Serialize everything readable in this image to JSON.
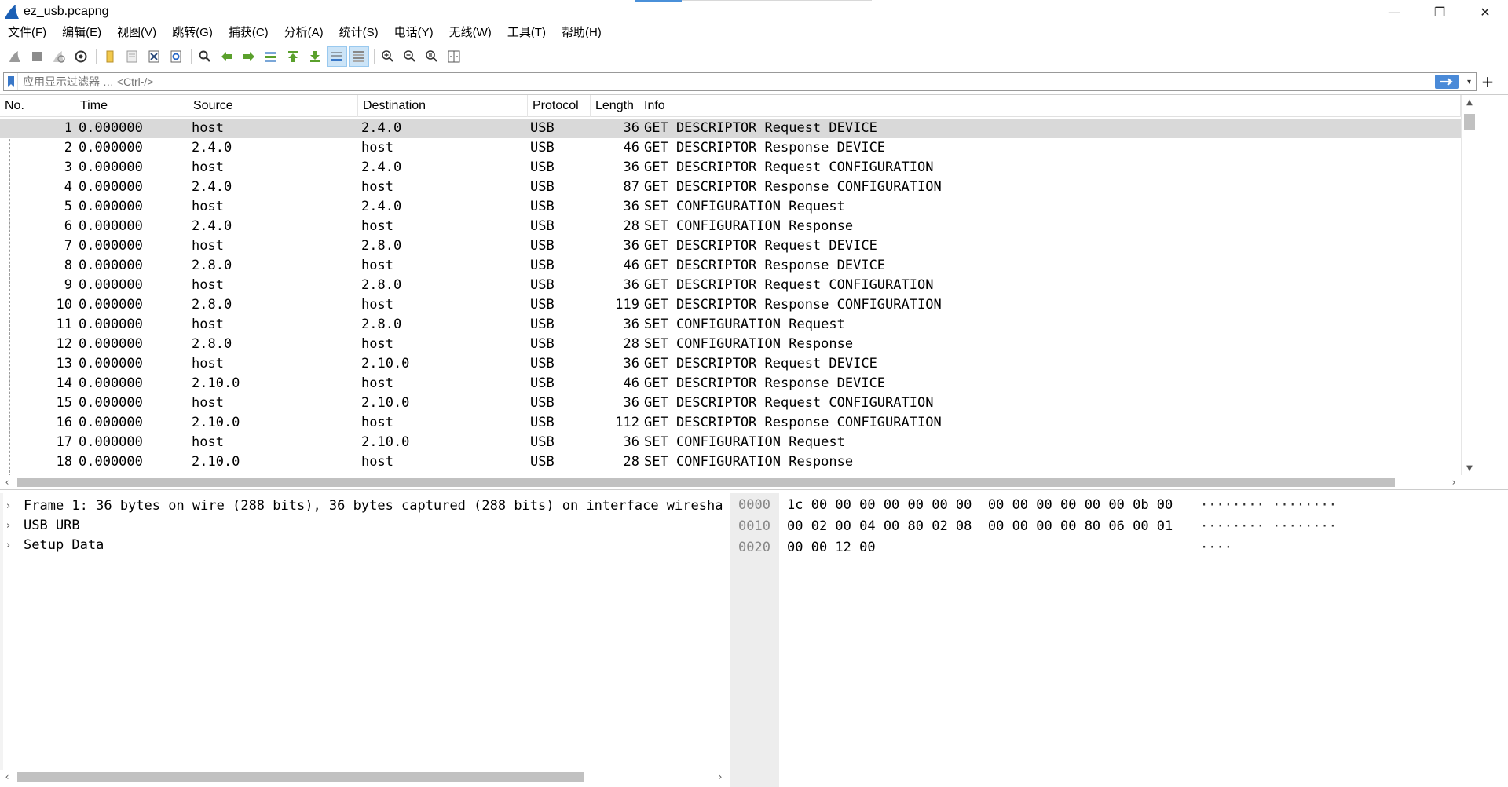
{
  "window": {
    "title": "ez_usb.pcapng",
    "minimize": "—",
    "restore": "❐",
    "close": "✕"
  },
  "menu": [
    "文件(F)",
    "编辑(E)",
    "视图(V)",
    "跳转(G)",
    "捕获(C)",
    "分析(A)",
    "统计(S)",
    "电话(Y)",
    "无线(W)",
    "工具(T)",
    "帮助(H)"
  ],
  "toolbar": {
    "icons": [
      "start-capture-icon",
      "stop-capture-icon",
      "restart-capture-icon",
      "capture-options-icon",
      "open-file-icon",
      "save-file-icon",
      "close-file-icon",
      "reload-file-icon",
      "find-packet-icon",
      "go-back-icon",
      "go-forward-icon",
      "go-to-packet-icon",
      "go-first-icon",
      "go-last-icon",
      "auto-scroll-icon",
      "colorize-icon",
      "zoom-in-icon",
      "zoom-out-icon",
      "normal-size-icon",
      "resize-columns-icon"
    ]
  },
  "filter": {
    "placeholder": "应用显示过滤器 … <Ctrl-/>",
    "plus": "+"
  },
  "packet_list": {
    "columns": [
      "No.",
      "Time",
      "Source",
      "Destination",
      "Protocol",
      "Length",
      "Info"
    ],
    "rows": [
      [
        "1",
        "0.000000",
        "host",
        "2.4.0",
        "USB",
        "36",
        "GET DESCRIPTOR Request DEVICE"
      ],
      [
        "2",
        "0.000000",
        "2.4.0",
        "host",
        "USB",
        "46",
        "GET DESCRIPTOR Response DEVICE"
      ],
      [
        "3",
        "0.000000",
        "host",
        "2.4.0",
        "USB",
        "36",
        "GET DESCRIPTOR Request CONFIGURATION"
      ],
      [
        "4",
        "0.000000",
        "2.4.0",
        "host",
        "USB",
        "87",
        "GET DESCRIPTOR Response CONFIGURATION"
      ],
      [
        "5",
        "0.000000",
        "host",
        "2.4.0",
        "USB",
        "36",
        "SET CONFIGURATION Request"
      ],
      [
        "6",
        "0.000000",
        "2.4.0",
        "host",
        "USB",
        "28",
        "SET CONFIGURATION Response"
      ],
      [
        "7",
        "0.000000",
        "host",
        "2.8.0",
        "USB",
        "36",
        "GET DESCRIPTOR Request DEVICE"
      ],
      [
        "8",
        "0.000000",
        "2.8.0",
        "host",
        "USB",
        "46",
        "GET DESCRIPTOR Response DEVICE"
      ],
      [
        "9",
        "0.000000",
        "host",
        "2.8.0",
        "USB",
        "36",
        "GET DESCRIPTOR Request CONFIGURATION"
      ],
      [
        "10",
        "0.000000",
        "2.8.0",
        "host",
        "USB",
        "119",
        "GET DESCRIPTOR Response CONFIGURATION"
      ],
      [
        "11",
        "0.000000",
        "host",
        "2.8.0",
        "USB",
        "36",
        "SET CONFIGURATION Request"
      ],
      [
        "12",
        "0.000000",
        "2.8.0",
        "host",
        "USB",
        "28",
        "SET CONFIGURATION Response"
      ],
      [
        "13",
        "0.000000",
        "host",
        "2.10.0",
        "USB",
        "36",
        "GET DESCRIPTOR Request DEVICE"
      ],
      [
        "14",
        "0.000000",
        "2.10.0",
        "host",
        "USB",
        "46",
        "GET DESCRIPTOR Response DEVICE"
      ],
      [
        "15",
        "0.000000",
        "host",
        "2.10.0",
        "USB",
        "36",
        "GET DESCRIPTOR Request CONFIGURATION"
      ],
      [
        "16",
        "0.000000",
        "2.10.0",
        "host",
        "USB",
        "112",
        "GET DESCRIPTOR Response CONFIGURATION"
      ],
      [
        "17",
        "0.000000",
        "host",
        "2.10.0",
        "USB",
        "36",
        "SET CONFIGURATION Request"
      ],
      [
        "18",
        "0.000000",
        "2.10.0",
        "host",
        "USB",
        "28",
        "SET CONFIGURATION Response"
      ]
    ],
    "selected_row": 0
  },
  "details": {
    "items": [
      "Frame 1: 36 bytes on wire (288 bits), 36 bytes captured (288 bits) on interface wiresha",
      "USB URB",
      "Setup Data"
    ]
  },
  "bytes": {
    "rows": [
      {
        "offset": "0000",
        "hex": "1c 00 00 00 00 00 00 00  00 00 00 00 00 00 0b 00",
        "ascii": "········ ········"
      },
      {
        "offset": "0010",
        "hex": "00 02 00 04 00 80 02 08  00 00 00 00 80 06 00 01",
        "ascii": "········ ········"
      },
      {
        "offset": "0020",
        "hex": "00 00 12 00",
        "ascii": "····"
      }
    ]
  }
}
